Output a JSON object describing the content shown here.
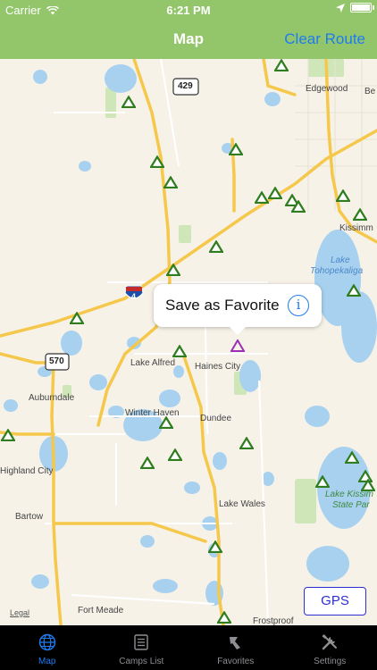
{
  "status_bar": {
    "carrier": "Carrier",
    "time": "6:21 PM"
  },
  "nav": {
    "title": "Map",
    "clear_route": "Clear Route"
  },
  "callout": {
    "text": "Save as Favorite"
  },
  "gps_label": "GPS",
  "map_labels": {
    "edgewood": "Edgewood",
    "be": "Be",
    "kissimmee": "Kissimm",
    "lake_toho_1": "Lake",
    "lake_toho_2": "Tohopekaliga",
    "lake_alfred": "Lake Alfred",
    "haines_city": "Haines City",
    "auburndale": "Auburndale",
    "winter_haven": "Winter Haven",
    "dundee": "Dundee",
    "highland_city": "Highland City",
    "bartow": "Bartow",
    "lake_wales": "Lake Wales",
    "lake_kissi": "Lake Kissim",
    "state_park": "State Par",
    "fort_meade": "Fort Meade",
    "frostproof": "Frostproof",
    "legal": "Legal",
    "hw429": "429",
    "hw4": "4",
    "hw570": "570"
  },
  "tabs": [
    {
      "label": "Map",
      "icon": "globe-icon"
    },
    {
      "label": "Camps List",
      "icon": "list-icon"
    },
    {
      "label": "Favorites",
      "icon": "camp-favorites-icon"
    },
    {
      "label": "Settings",
      "icon": "tools-icon"
    }
  ],
  "colors": {
    "header_green": "#93c66a",
    "accent_blue": "#1e7bf0",
    "camp_marker": "#2f7d1f",
    "selected_marker": "#9b2fb5",
    "water": "#a8d1f0",
    "road": "#f5c84c",
    "park": "#cfe6b8"
  }
}
